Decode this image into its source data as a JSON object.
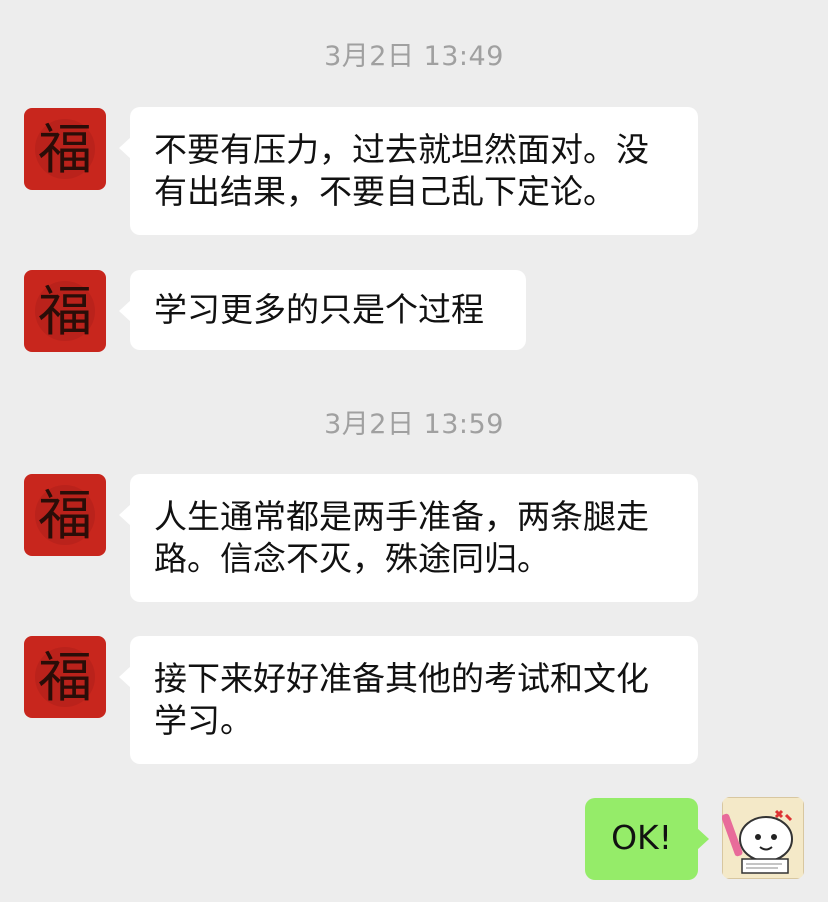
{
  "chat": {
    "timestamps": [
      "3月2日 13:49",
      "3月2日 13:59"
    ],
    "messages": [
      {
        "side": "in",
        "text": "不要有压力，过去就坦然面对。没有出结果，不要自己乱下定论。"
      },
      {
        "side": "in",
        "text": "学习更多的只是个过程"
      },
      {
        "side": "in",
        "text": "人生通常都是两手准备，两条腿走路。信念不灭，殊途同归。"
      },
      {
        "side": "in",
        "text": "接下来好好准备其他的考试和文化学习。"
      },
      {
        "side": "out",
        "text": "OK!"
      }
    ]
  },
  "avatars": {
    "contact": {
      "icon": "fu-calligraphy-avatar",
      "glyph": "福",
      "color": "#c8261d"
    },
    "self": {
      "icon": "cartoon-sticker-avatar"
    }
  },
  "colors": {
    "background": "#ededed",
    "incoming_bubble": "#ffffff",
    "outgoing_bubble": "#95ec69",
    "timestamp": "#a0a0a0"
  }
}
